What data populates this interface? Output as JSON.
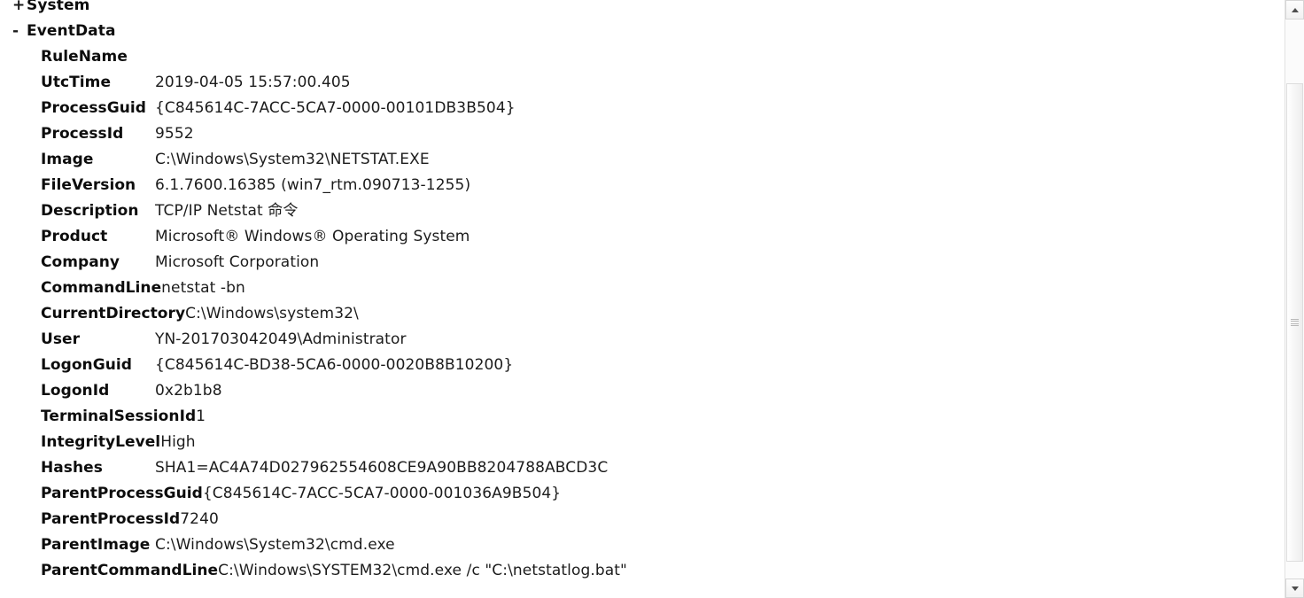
{
  "window": {
    "title": "Event XML Details",
    "background_color": "#ffffff",
    "text_color": "#1c1c1c"
  },
  "tree": {
    "nodes": [
      {
        "toggle": "+",
        "label": "System",
        "expanded": false
      },
      {
        "toggle": "-",
        "label": "EventData",
        "expanded": true
      }
    ]
  },
  "event_data": {
    "fields": [
      {
        "name": "RuleName",
        "value": ""
      },
      {
        "name": "UtcTime",
        "value": "2019-04-05 15:57:00.405"
      },
      {
        "name": "ProcessGuid",
        "value": "{C845614C-7ACC-5CA7-0000-00101DB3B504}"
      },
      {
        "name": "ProcessId",
        "value": "9552"
      },
      {
        "name": "Image",
        "value": "C:\\Windows\\System32\\NETSTAT.EXE"
      },
      {
        "name": "FileVersion",
        "value": "6.1.7600.16385 (win7_rtm.090713-1255)"
      },
      {
        "name": "Description",
        "value": "TCP/IP Netstat 命令"
      },
      {
        "name": "Product",
        "value": "Microsoft® Windows® Operating System"
      },
      {
        "name": "Company",
        "value": "Microsoft Corporation"
      },
      {
        "name": "CommandLine",
        "value": "netstat -bn"
      },
      {
        "name": "CurrentDirectory",
        "value": "C:\\Windows\\system32\\"
      },
      {
        "name": "User",
        "value": "YN-201703042049\\Administrator"
      },
      {
        "name": "LogonGuid",
        "value": "{C845614C-BD38-5CA6-0000-0020B8B10200}"
      },
      {
        "name": "LogonId",
        "value": "0x2b1b8"
      },
      {
        "name": "TerminalSessionId",
        "value": "1"
      },
      {
        "name": "IntegrityLevel",
        "value": "High"
      },
      {
        "name": "Hashes",
        "value": "SHA1=AC4A74D027962554608CE9A90BB8204788ABCD3C"
      },
      {
        "name": "ParentProcessGuid",
        "value": "{C845614C-7ACC-5CA7-0000-001036A9B504}"
      },
      {
        "name": "ParentProcessId",
        "value": "7240"
      },
      {
        "name": "ParentImage",
        "value": "C:\\Windows\\System32\\cmd.exe"
      },
      {
        "name": "ParentCommandLine",
        "value": "C:\\Windows\\SYSTEM32\\cmd.exe /c \"C:\\netstatlog.bat\""
      }
    ]
  },
  "scrollbar": {
    "up_arrow": "▲",
    "down_arrow": "▼",
    "orientation": "vertical"
  }
}
